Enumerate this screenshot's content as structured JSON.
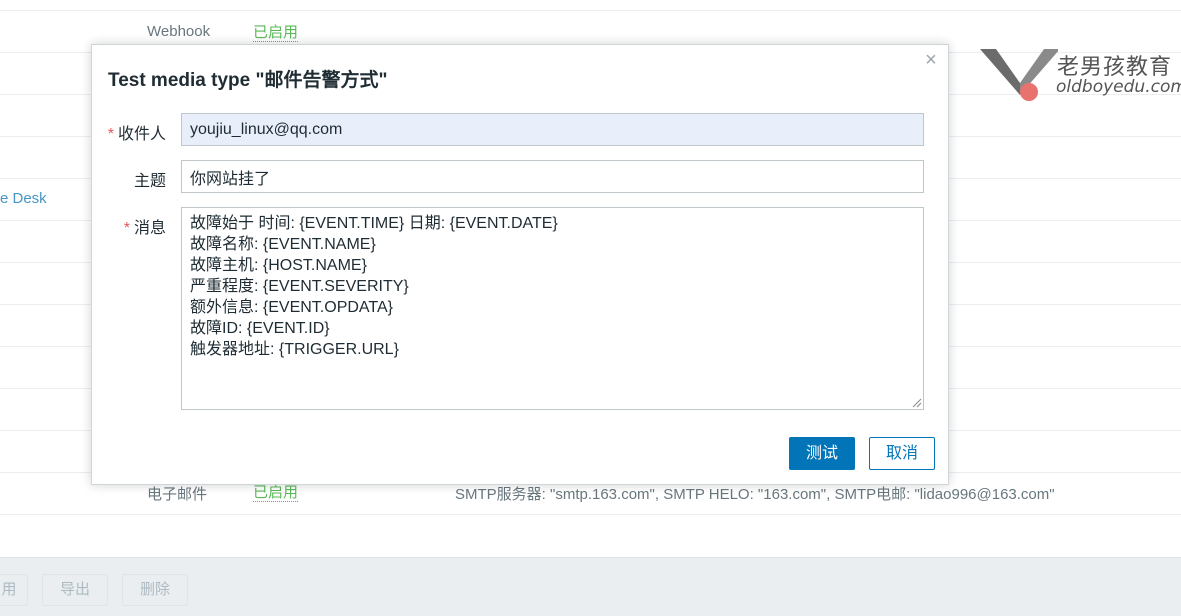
{
  "background": {
    "top_row": {
      "type": "Webhook",
      "status": "已启用"
    },
    "left_link": "e Desk",
    "email_row": {
      "type": "电子邮件",
      "status": "已启用",
      "details": "SMTP服务器: \"smtp.163.com\", SMTP HELO: \"163.com\", SMTP电邮: \"lidao996@163.com\""
    },
    "bottom_buttons": [
      "用",
      "导出",
      "删除"
    ]
  },
  "logo": {
    "cn": "老男孩教育",
    "en": "oldboyedu.com"
  },
  "dialog": {
    "title": "Test media type \"邮件告警方式\"",
    "close_symbol": "×",
    "required_marker": "*",
    "fields": {
      "to": {
        "label": "收件人",
        "value": "youjiu_linux@qq.com"
      },
      "subject": {
        "label": "主题",
        "value": "你网站挂了"
      },
      "message": {
        "label": "消息",
        "value": "故障始于 时间: {EVENT.TIME} 日期: {EVENT.DATE}\n故障名称: {EVENT.NAME}\n故障主机: {HOST.NAME}\n严重程度: {EVENT.SEVERITY}\n额外信息: {EVENT.OPDATA}\n故障ID: {EVENT.ID}\n触发器地址: {TRIGGER.URL}"
      }
    },
    "buttons": {
      "test": "测试",
      "cancel": "取消"
    }
  },
  "colors": {
    "primary": "#0275b8",
    "enabled_green": "#59b957",
    "required_red": "#e45959"
  }
}
